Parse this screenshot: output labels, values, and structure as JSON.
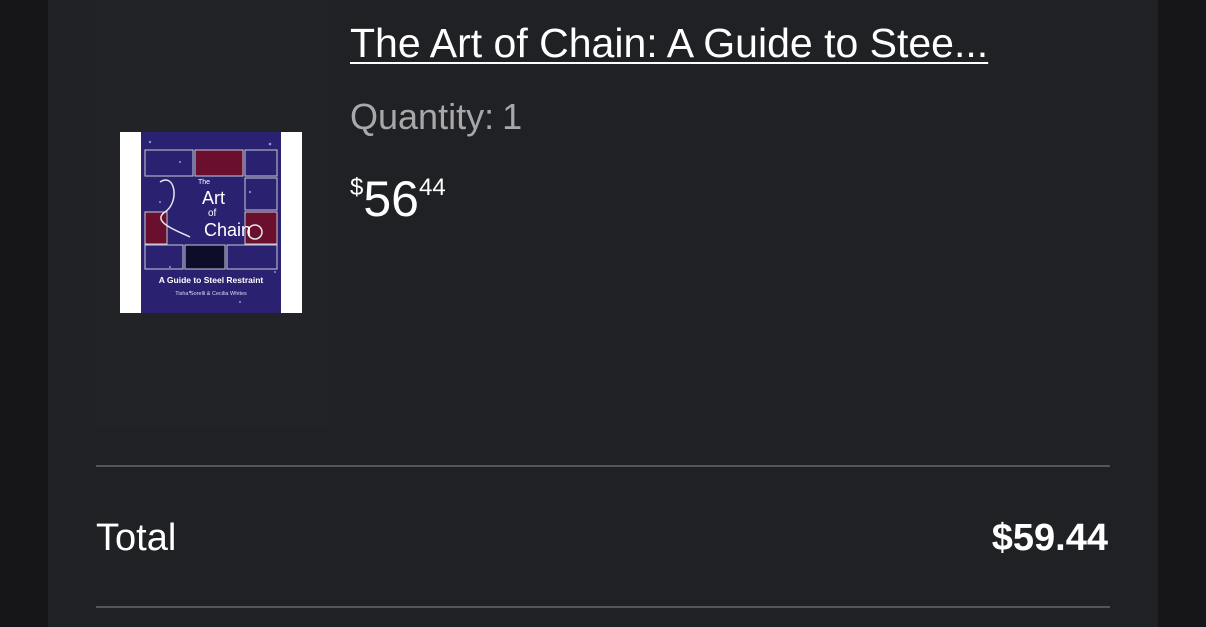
{
  "item": {
    "title": "The Art of Chain: A Guide to Stee...",
    "quantity_label": "Quantity:",
    "quantity_value": "1",
    "price_symbol": "$",
    "price_whole": "56",
    "price_fraction": "44",
    "cover": {
      "title_top": "The",
      "title_mid1": "Art",
      "title_mid2": "of",
      "title_main": "Chain",
      "subtitle": "A Guide to Steel Restraint",
      "authors": "Tisha Sorelli & Cecilia Whites",
      "colors": {
        "background": "#2a2270",
        "panel": "#6b0f2e",
        "accent": "#ffffff"
      }
    }
  },
  "summary": {
    "total_label": "Total",
    "total_value": "$59.44"
  }
}
